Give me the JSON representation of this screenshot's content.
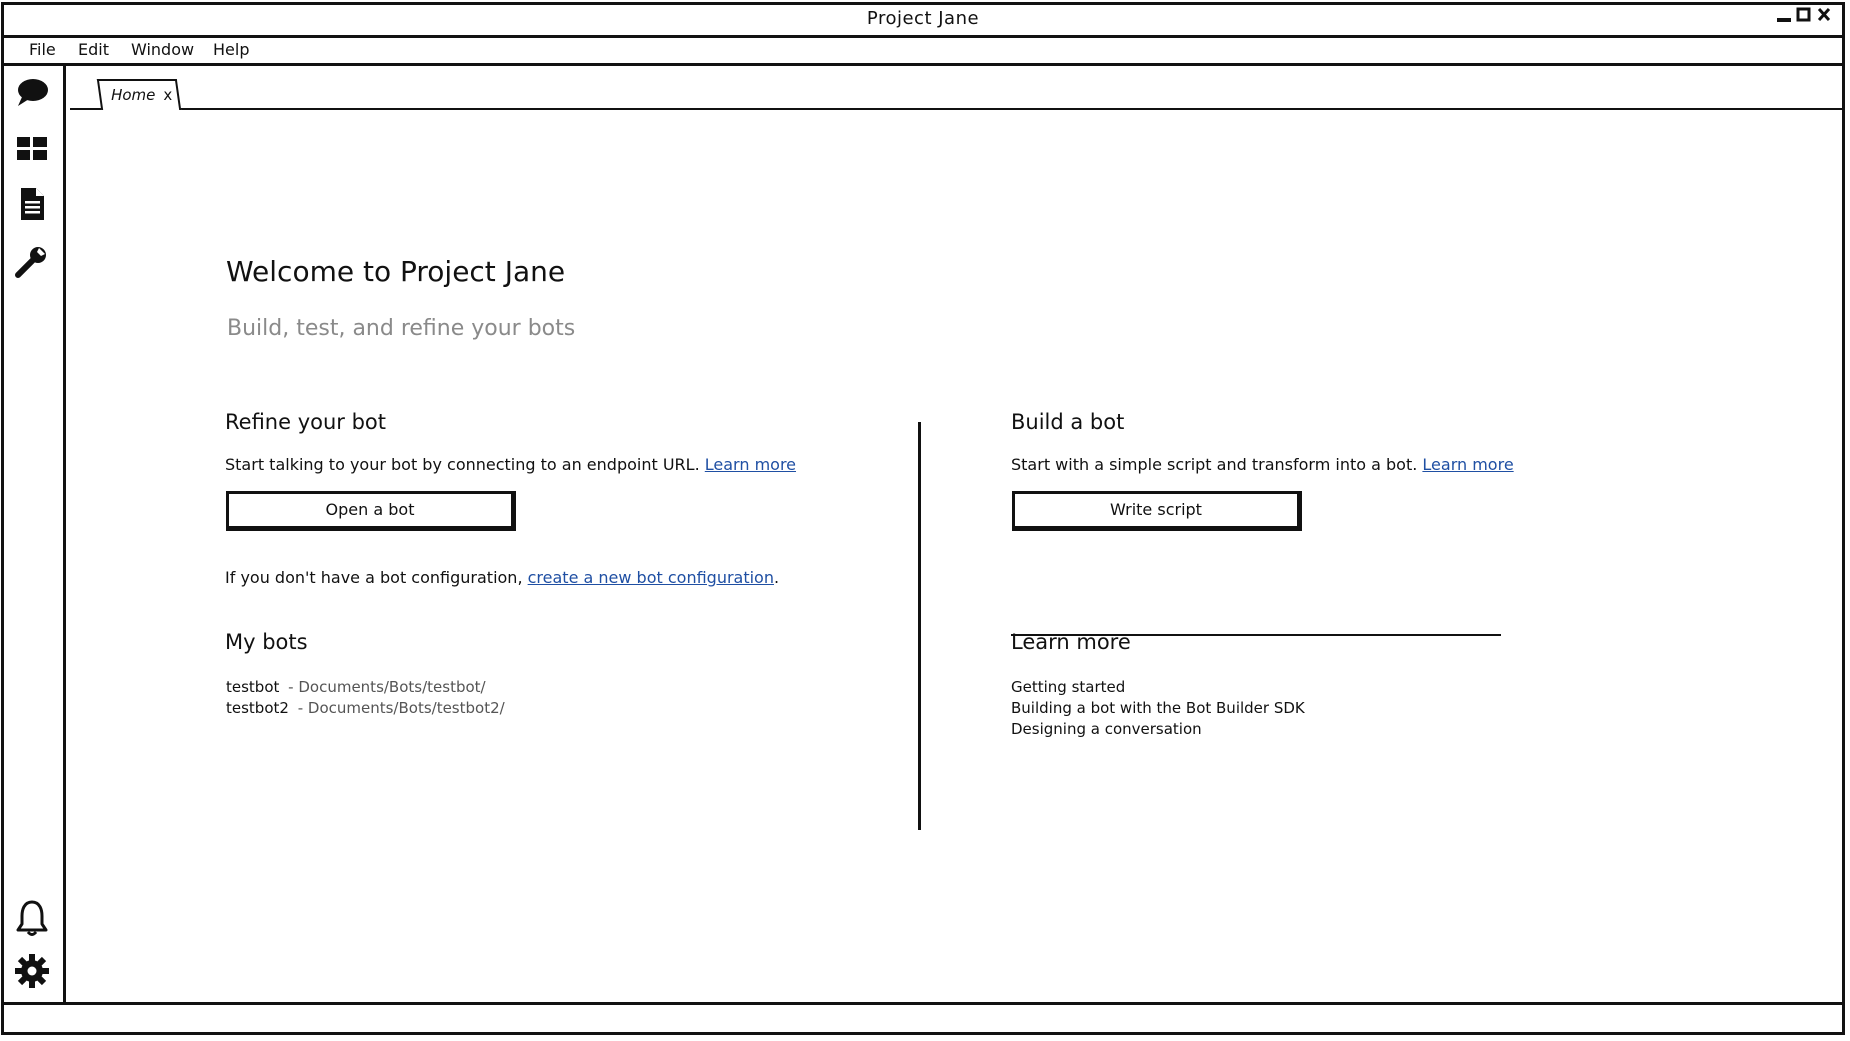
{
  "window": {
    "title": "Project Jane",
    "controls": [
      "minimize-icon",
      "maximize-icon",
      "close-icon"
    ]
  },
  "menubar": {
    "items": [
      "File",
      "Edit",
      "Window",
      "Help"
    ]
  },
  "sidebar": {
    "top_icons": [
      "chat-icon",
      "dashboard-icon",
      "document-icon",
      "wrench-icon"
    ],
    "bottom_icons": [
      "bell-icon",
      "gear-icon"
    ]
  },
  "tabs": [
    {
      "label": "Home",
      "close": "x",
      "active": true
    }
  ],
  "welcome": {
    "title": "Welcome to Project Jane",
    "subtitle": "Build, test, and refine your bots"
  },
  "refine": {
    "heading": "Refine your bot",
    "text": "Start talking to your bot by connecting to an endpoint URL.",
    "learn_more": "Learn more",
    "button": "Open a bot",
    "no_config_text": "If you don't have a bot configuration,",
    "no_config_link": "create a new bot configuration",
    "no_config_end": "."
  },
  "my_bots": {
    "heading": "My bots",
    "items": [
      {
        "name": "testbot",
        "path": "- Documents/Bots/testbot/"
      },
      {
        "name": "testbot2",
        "path": "- Documents/Bots/testbot2/"
      }
    ]
  },
  "build": {
    "heading": "Build a bot",
    "text": "Start with a simple script and transform into a bot.",
    "learn_more": "Learn more",
    "button": "Write script"
  },
  "learn_more": {
    "heading": "Learn more",
    "items": [
      "Getting started",
      "Building a bot with the Bot Builder SDK",
      "Designing a conversation"
    ]
  }
}
